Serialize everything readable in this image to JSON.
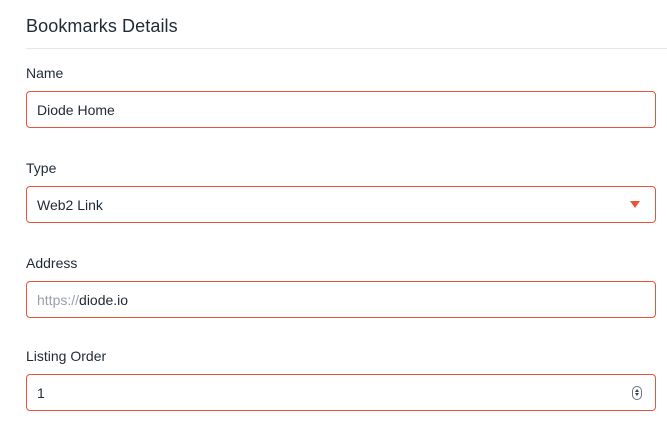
{
  "section": {
    "title": "Bookmarks Details"
  },
  "fields": {
    "name": {
      "label": "Name",
      "value": "Diode Home"
    },
    "type": {
      "label": "Type",
      "selected": "Web2 Link"
    },
    "address": {
      "label": "Address",
      "prefix": "https://",
      "value": "diode.io"
    },
    "listing_order": {
      "label": "Listing Order",
      "value": "1"
    }
  },
  "colors": {
    "accent": "#e5553a",
    "divider": "#e5e7eb",
    "prefix_text": "#9aa0a6"
  },
  "icons": {
    "type_dropdown": "caret-down-icon",
    "listing_order_stepper": "stepper-icon"
  }
}
